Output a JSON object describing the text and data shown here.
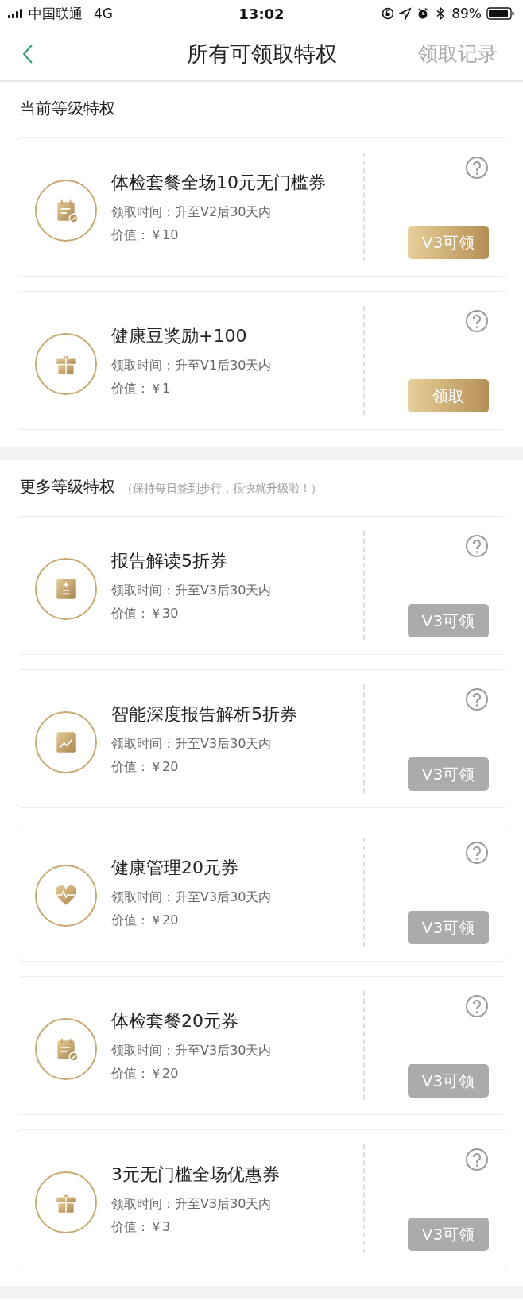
{
  "status_bar": {
    "carrier": "中国联通",
    "network": "4G",
    "time": "13:02",
    "battery": "89%"
  },
  "nav": {
    "title": "所有可领取特权",
    "action": "领取记录"
  },
  "sections": [
    {
      "title": "当前等级特权",
      "items": [
        {
          "kind": "calendar",
          "title": "体检套餐全场10元无门槛券",
          "time": "领取时间：升至V2后30天内",
          "value": "价值：￥10",
          "button": "V3可领",
          "claimable": true
        },
        {
          "kind": "gift",
          "title": "健康豆奖励+100",
          "time": "领取时间：升至V1后30天内",
          "value": "价值：￥1",
          "button": "领取",
          "claimable": true
        }
      ]
    },
    {
      "title": "更多等级特权",
      "hint": "（保持每日签到步行，很快就升级啦！）",
      "items": [
        {
          "kind": "calculator",
          "title": "报告解读5折券",
          "time": "领取时间：升至V3后30天内",
          "value": "价值：￥30",
          "button": "V3可领",
          "claimable": false
        },
        {
          "kind": "chart",
          "title": "智能深度报告解析5折券",
          "time": "领取时间：升至V3后30天内",
          "value": "价值：￥20",
          "button": "V3可领",
          "claimable": false
        },
        {
          "kind": "heart",
          "title": "健康管理20元券",
          "time": "领取时间：升至V3后30天内",
          "value": "价值：￥20",
          "button": "V3可领",
          "claimable": false
        },
        {
          "kind": "calendar",
          "title": "体检套餐20元券",
          "time": "领取时间：升至V3后30天内",
          "value": "价值：￥20",
          "button": "V3可领",
          "claimable": false
        },
        {
          "kind": "gift",
          "title": "3元无门槛全场优惠券",
          "time": "领取时间：升至V3后30天内",
          "value": "价值：￥3",
          "button": "V3可领",
          "claimable": false
        }
      ]
    }
  ]
}
